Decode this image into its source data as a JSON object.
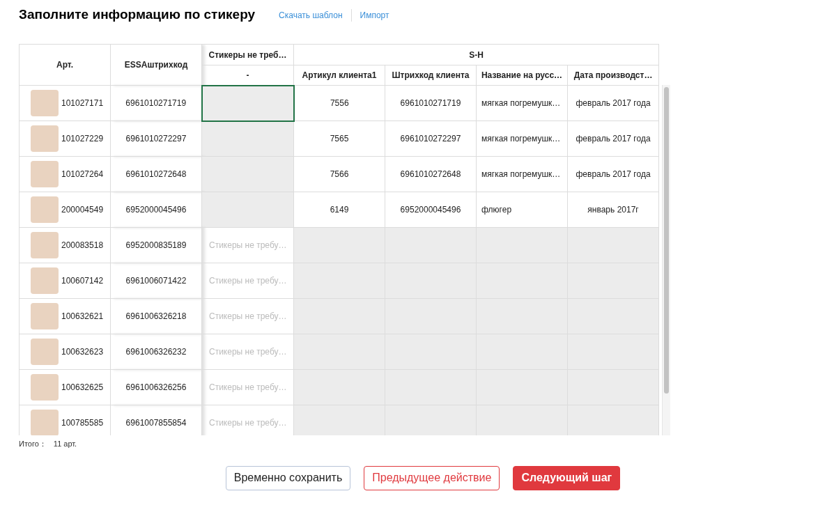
{
  "title": "Заполните информацию по стикеру",
  "links": [
    "Скачать шаблон",
    "Импорт"
  ],
  "table": {
    "columns": [
      "Арт.",
      "ESSAштрихкод",
      "Стикеры не треб…"
    ],
    "group_title": "S-H",
    "sub_columns": [
      "-",
      "Артикул клиента1",
      "Штрихкод клиента",
      "Название на русс…",
      "Дата производст…"
    ],
    "rows": [
      {
        "kind": "custom",
        "art": "101027171",
        "barcode": "6961010271719",
        "sticker_selected": true,
        "client_art": "7556",
        "client_barcode": "6961010271719",
        "name_ru": "мягкая погремушк…",
        "date": "февраль 2017 года"
      },
      {
        "kind": "custom",
        "art": "101027229",
        "barcode": "6961010272297",
        "sticker_selected": false,
        "client_art": "7565",
        "client_barcode": "6961010272297",
        "name_ru": "мягкая погремушк…",
        "date": "февраль 2017 года"
      },
      {
        "kind": "custom",
        "art": "101027264",
        "barcode": "6961010272648",
        "sticker_selected": false,
        "client_art": "7566",
        "client_barcode": "6961010272648",
        "name_ru": "мягкая погремушк…",
        "date": "февраль 2017 года"
      },
      {
        "kind": "custom",
        "art": "200004549",
        "barcode": "6952000045496",
        "sticker_selected": false,
        "client_art": "6149",
        "client_barcode": "6952000045496",
        "name_ru": "флюгер",
        "date": "январь 2017г"
      },
      {
        "kind": "none",
        "art": "200083518",
        "barcode": "6952000835189",
        "sticker": "Стикеры не требу…"
      },
      {
        "kind": "none",
        "art": "100607142",
        "barcode": "6961006071422",
        "sticker": "Стикеры не требу…"
      },
      {
        "kind": "none",
        "art": "100632621",
        "barcode": "6961006326218",
        "sticker": "Стикеры не требу…"
      },
      {
        "kind": "none",
        "art": "100632623",
        "barcode": "6961006326232",
        "sticker": "Стикеры не требу…"
      },
      {
        "kind": "none",
        "art": "100632625",
        "barcode": "6961006326256",
        "sticker": "Стикеры не требу…"
      },
      {
        "kind": "none",
        "art": "100785585",
        "barcode": "6961007855854",
        "sticker": "Стикеры не требу…"
      }
    ]
  },
  "total_label": "Итого：",
  "total_value": "11 арт.",
  "buttons": [
    {
      "kind": "outline",
      "label": "Временно сохранить"
    },
    {
      "kind": "danger-outline",
      "label": "Предыдущее действие"
    },
    {
      "kind": "danger",
      "label": "Следующий шаг"
    }
  ]
}
